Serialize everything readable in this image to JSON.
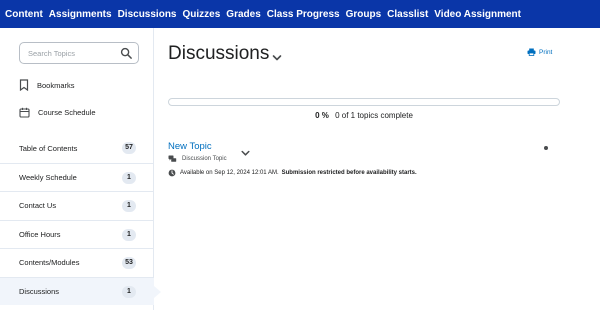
{
  "nav": {
    "items": [
      {
        "label": "Content"
      },
      {
        "label": "Assignments"
      },
      {
        "label": "Discussions"
      },
      {
        "label": "Quizzes"
      },
      {
        "label": "Grades"
      },
      {
        "label": "Class Progress"
      },
      {
        "label": "Groups"
      },
      {
        "label": "Classlist"
      },
      {
        "label": "Video Assignment"
      }
    ]
  },
  "sidebar": {
    "search": {
      "placeholder": "Search Topics",
      "value": ""
    },
    "links": [
      {
        "label": "Bookmarks",
        "icon": "bookmark-icon"
      },
      {
        "label": "Course Schedule",
        "icon": "calendar-icon"
      }
    ],
    "toc": [
      {
        "label": "Table of Contents",
        "count": "57"
      },
      {
        "label": "Weekly Schedule",
        "count": "1"
      },
      {
        "label": "Contact Us",
        "count": "1"
      },
      {
        "label": "Office Hours",
        "count": "1"
      },
      {
        "label": "Contents/Modules",
        "count": "53"
      },
      {
        "label": "Discussions",
        "count": "1",
        "active": true
      }
    ]
  },
  "main": {
    "title": "Discussions",
    "print_label": "Print",
    "progress": {
      "percent_label": "0 %",
      "summary": "0 of 1 topics complete",
      "fraction": 0
    },
    "topic": {
      "title": "New Topic",
      "type_label": "Discussion Topic",
      "availability": "Available on Sep 12, 2024 12:01 AM.",
      "restriction": "Submission restricted before availability starts."
    }
  },
  "colors": {
    "nav_bg": "#0a36a8",
    "link": "#006fbf",
    "badge_bg": "#e3e9f1"
  }
}
